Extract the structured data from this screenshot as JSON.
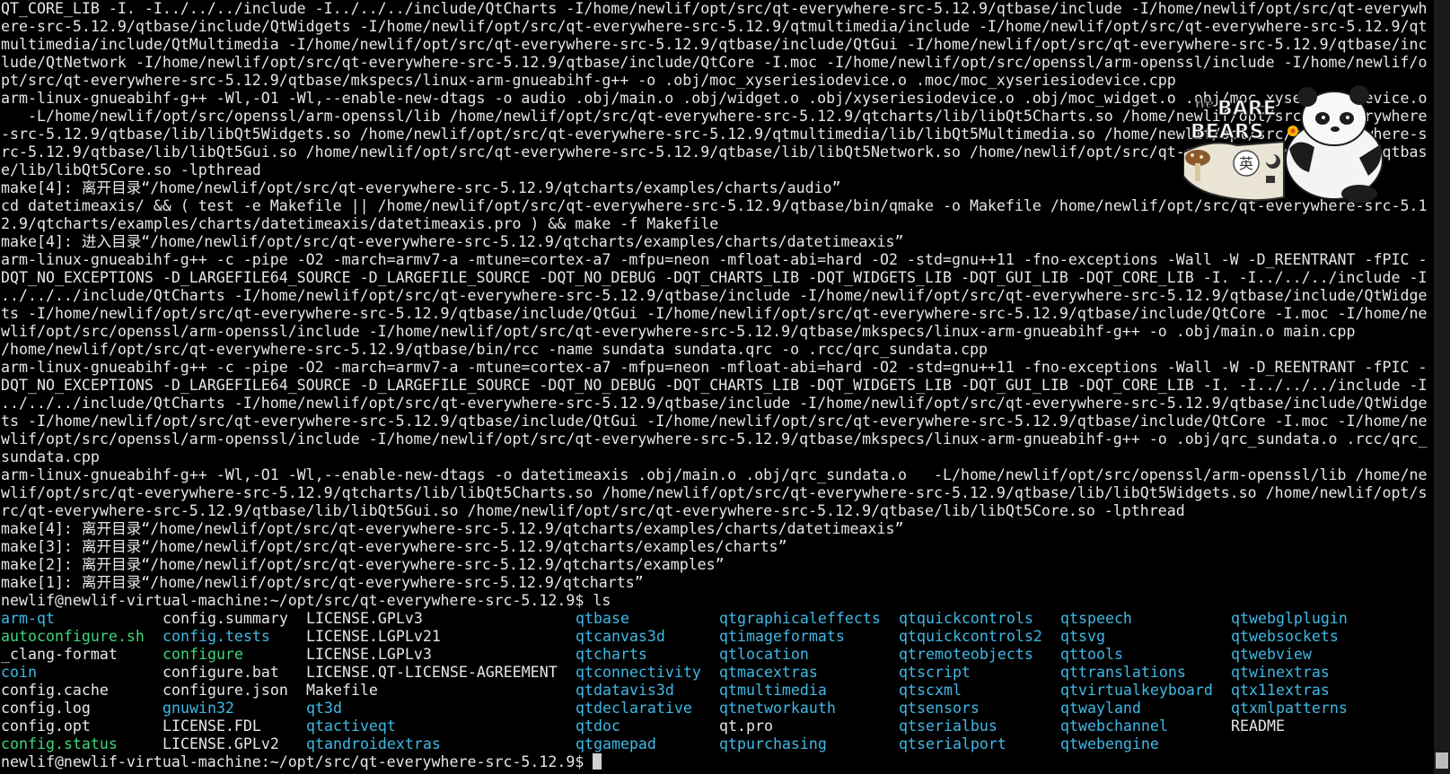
{
  "colors": {
    "background": "#000000",
    "text": "#e6e6e6",
    "directory": "#3fb9e6",
    "executable": "#3fd67a"
  },
  "sticker": {
    "line1": "We",
    "line2": "BARE",
    "line3": "BEARS",
    "ime_label": "英",
    "icon": "panda-bear-sticker-icon"
  },
  "build_output": [
    "QT_CORE_LIB -I. -I../../../include -I../../../include/QtCharts -I/home/newlif/opt/src/qt-everywhere-src-5.12.9/qtbase/include -I/home/newlif/opt/src/qt-everywh",
    "ere-src-5.12.9/qtbase/include/QtWidgets -I/home/newlif/opt/src/qt-everywhere-src-5.12.9/qtmultimedia/include -I/home/newlif/opt/src/qt-everywhere-src-5.12.9/qt",
    "multimedia/include/QtMultimedia -I/home/newlif/opt/src/qt-everywhere-src-5.12.9/qtbase/include/QtGui -I/home/newlif/opt/src/qt-everywhere-src-5.12.9/qtbase/inc",
    "lude/QtNetwork -I/home/newlif/opt/src/qt-everywhere-src-5.12.9/qtbase/include/QtCore -I.moc -I/home/newlif/opt/src/openssl/arm-openssl/include -I/home/newlif/o",
    "pt/src/qt-everywhere-src-5.12.9/qtbase/mkspecs/linux-arm-gnueabihf-g++ -o .obj/moc_xyseriesiodevice.o .moc/moc_xyseriesiodevice.cpp",
    "arm-linux-gnueabihf-g++ -Wl,-O1 -Wl,--enable-new-dtags -o audio .obj/main.o .obj/widget.o .obj/xyseriesiodevice.o .obj/moc_widget.o .obj/moc_xyseriesiodevice.o",
    "   -L/home/newlif/opt/src/openssl/arm-openssl/lib /home/newlif/opt/src/qt-everywhere-src-5.12.9/qtcharts/lib/libQt5Charts.so /home/newlif/opt/src/qt-everywhere",
    "-src-5.12.9/qtbase/lib/libQt5Widgets.so /home/newlif/opt/src/qt-everywhere-src-5.12.9/qtmultimedia/lib/libQt5Multimedia.so /home/newlif/opt/src/qt-everywhere-s",
    "rc-5.12.9/qtbase/lib/libQt5Gui.so /home/newlif/opt/src/qt-everywhere-src-5.12.9/qtbase/lib/libQt5Network.so /home/newlif/opt/src/qt-everywhere-src-5.12.9/qtbas",
    "e/lib/libQt5Core.so -lpthread",
    "make[4]: 离开目录“/home/newlif/opt/src/qt-everywhere-src-5.12.9/qtcharts/examples/charts/audio”",
    "cd datetimeaxis/ && ( test -e Makefile || /home/newlif/opt/src/qt-everywhere-src-5.12.9/qtbase/bin/qmake -o Makefile /home/newlif/opt/src/qt-everywhere-src-5.1",
    "2.9/qtcharts/examples/charts/datetimeaxis/datetimeaxis.pro ) && make -f Makefile",
    "make[4]: 进入目录“/home/newlif/opt/src/qt-everywhere-src-5.12.9/qtcharts/examples/charts/datetimeaxis”",
    "arm-linux-gnueabihf-g++ -c -pipe -O2 -march=armv7-a -mtune=cortex-a7 -mfpu=neon -mfloat-abi=hard -O2 -std=gnu++11 -fno-exceptions -Wall -W -D_REENTRANT -fPIC -",
    "DQT_NO_EXCEPTIONS -D_LARGEFILE64_SOURCE -D_LARGEFILE_SOURCE -DQT_NO_DEBUG -DQT_CHARTS_LIB -DQT_WIDGETS_LIB -DQT_GUI_LIB -DQT_CORE_LIB -I. -I../../../include -I",
    "../../../include/QtCharts -I/home/newlif/opt/src/qt-everywhere-src-5.12.9/qtbase/include -I/home/newlif/opt/src/qt-everywhere-src-5.12.9/qtbase/include/QtWidge",
    "ts -I/home/newlif/opt/src/qt-everywhere-src-5.12.9/qtbase/include/QtGui -I/home/newlif/opt/src/qt-everywhere-src-5.12.9/qtbase/include/QtCore -I.moc -I/home/ne",
    "wlif/opt/src/openssl/arm-openssl/include -I/home/newlif/opt/src/qt-everywhere-src-5.12.9/qtbase/mkspecs/linux-arm-gnueabihf-g++ -o .obj/main.o main.cpp",
    "/home/newlif/opt/src/qt-everywhere-src-5.12.9/qtbase/bin/rcc -name sundata sundata.qrc -o .rcc/qrc_sundata.cpp",
    "arm-linux-gnueabihf-g++ -c -pipe -O2 -march=armv7-a -mtune=cortex-a7 -mfpu=neon -mfloat-abi=hard -O2 -std=gnu++11 -fno-exceptions -Wall -W -D_REENTRANT -fPIC -",
    "DQT_NO_EXCEPTIONS -D_LARGEFILE64_SOURCE -D_LARGEFILE_SOURCE -DQT_NO_DEBUG -DQT_CHARTS_LIB -DQT_WIDGETS_LIB -DQT_GUI_LIB -DQT_CORE_LIB -I. -I../../../include -I",
    "../../../include/QtCharts -I/home/newlif/opt/src/qt-everywhere-src-5.12.9/qtbase/include -I/home/newlif/opt/src/qt-everywhere-src-5.12.9/qtbase/include/QtWidge",
    "ts -I/home/newlif/opt/src/qt-everywhere-src-5.12.9/qtbase/include/QtGui -I/home/newlif/opt/src/qt-everywhere-src-5.12.9/qtbase/include/QtCore -I.moc -I/home/ne",
    "wlif/opt/src/openssl/arm-openssl/include -I/home/newlif/opt/src/qt-everywhere-src-5.12.9/qtbase/mkspecs/linux-arm-gnueabihf-g++ -o .obj/qrc_sundata.o .rcc/qrc_",
    "sundata.cpp",
    "arm-linux-gnueabihf-g++ -Wl,-O1 -Wl,--enable-new-dtags -o datetimeaxis .obj/main.o .obj/qrc_sundata.o   -L/home/newlif/opt/src/openssl/arm-openssl/lib /home/ne",
    "wlif/opt/src/qt-everywhere-src-5.12.9/qtcharts/lib/libQt5Charts.so /home/newlif/opt/src/qt-everywhere-src-5.12.9/qtbase/lib/libQt5Widgets.so /home/newlif/opt/s",
    "rc/qt-everywhere-src-5.12.9/qtbase/lib/libQt5Gui.so /home/newlif/opt/src/qt-everywhere-src-5.12.9/qtbase/lib/libQt5Core.so -lpthread",
    "make[4]: 离开目录“/home/newlif/opt/src/qt-everywhere-src-5.12.9/qtcharts/examples/charts/datetimeaxis”",
    "make[3]: 离开目录“/home/newlif/opt/src/qt-everywhere-src-5.12.9/qtcharts/examples/charts”",
    "make[2]: 离开目录“/home/newlif/opt/src/qt-everywhere-src-5.12.9/qtcharts/examples”",
    "make[1]: 离开目录“/home/newlif/opt/src/qt-everywhere-src-5.12.9/qtcharts”"
  ],
  "prompt": "newlif@newlif-virtual-machine:~/opt/src/qt-everywhere-src-5.12.9$ ",
  "command": "ls",
  "ls_rows": [
    [
      {
        "name": "arm-qt",
        "kind": "dir"
      },
      {
        "name": "config.summary",
        "kind": "file"
      },
      {
        "name": "LICENSE.GPLv3",
        "kind": "file"
      },
      {
        "name": "qtbase",
        "kind": "dir"
      },
      {
        "name": "qtgraphicaleffects",
        "kind": "dir"
      },
      {
        "name": "qtquickcontrols",
        "kind": "dir"
      },
      {
        "name": "qtspeech",
        "kind": "dir"
      },
      {
        "name": "qtwebglplugin",
        "kind": "dir"
      }
    ],
    [
      {
        "name": "autoconfigure.sh",
        "kind": "exec"
      },
      {
        "name": "config.tests",
        "kind": "dir"
      },
      {
        "name": "LICENSE.LGPLv21",
        "kind": "file"
      },
      {
        "name": "qtcanvas3d",
        "kind": "dir"
      },
      {
        "name": "qtimageformats",
        "kind": "dir"
      },
      {
        "name": "qtquickcontrols2",
        "kind": "dir"
      },
      {
        "name": "qtsvg",
        "kind": "dir"
      },
      {
        "name": "qtwebsockets",
        "kind": "dir"
      }
    ],
    [
      {
        "name": "_clang-format",
        "kind": "file"
      },
      {
        "name": "configure",
        "kind": "exec"
      },
      {
        "name": "LICENSE.LGPLv3",
        "kind": "file"
      },
      {
        "name": "qtcharts",
        "kind": "dir"
      },
      {
        "name": "qtlocation",
        "kind": "dir"
      },
      {
        "name": "qtremoteobjects",
        "kind": "dir"
      },
      {
        "name": "qttools",
        "kind": "dir"
      },
      {
        "name": "qtwebview",
        "kind": "dir"
      }
    ],
    [
      {
        "name": "coin",
        "kind": "dir"
      },
      {
        "name": "configure.bat",
        "kind": "file"
      },
      {
        "name": "LICENSE.QT-LICENSE-AGREEMENT",
        "kind": "file"
      },
      {
        "name": "qtconnectivity",
        "kind": "dir"
      },
      {
        "name": "qtmacextras",
        "kind": "dir"
      },
      {
        "name": "qtscript",
        "kind": "dir"
      },
      {
        "name": "qttranslations",
        "kind": "dir"
      },
      {
        "name": "qtwinextras",
        "kind": "dir"
      }
    ],
    [
      {
        "name": "config.cache",
        "kind": "file"
      },
      {
        "name": "configure.json",
        "kind": "file"
      },
      {
        "name": "Makefile",
        "kind": "file"
      },
      {
        "name": "qtdatavis3d",
        "kind": "dir"
      },
      {
        "name": "qtmultimedia",
        "kind": "dir"
      },
      {
        "name": "qtscxml",
        "kind": "dir"
      },
      {
        "name": "qtvirtualkeyboard",
        "kind": "dir"
      },
      {
        "name": "qtx11extras",
        "kind": "dir"
      }
    ],
    [
      {
        "name": "config.log",
        "kind": "file"
      },
      {
        "name": "gnuwin32",
        "kind": "dir"
      },
      {
        "name": "qt3d",
        "kind": "dir"
      },
      {
        "name": "qtdeclarative",
        "kind": "dir"
      },
      {
        "name": "qtnetworkauth",
        "kind": "dir"
      },
      {
        "name": "qtsensors",
        "kind": "dir"
      },
      {
        "name": "qtwayland",
        "kind": "dir"
      },
      {
        "name": "qtxmlpatterns",
        "kind": "dir"
      }
    ],
    [
      {
        "name": "config.opt",
        "kind": "file"
      },
      {
        "name": "LICENSE.FDL",
        "kind": "file"
      },
      {
        "name": "qtactiveqt",
        "kind": "dir"
      },
      {
        "name": "qtdoc",
        "kind": "dir"
      },
      {
        "name": "qt.pro",
        "kind": "file"
      },
      {
        "name": "qtserialbus",
        "kind": "dir"
      },
      {
        "name": "qtwebchannel",
        "kind": "dir"
      },
      {
        "name": "README",
        "kind": "file"
      }
    ],
    [
      {
        "name": "config.status",
        "kind": "exec"
      },
      {
        "name": "LICENSE.GPLv2",
        "kind": "file"
      },
      {
        "name": "qtandroidextras",
        "kind": "dir"
      },
      {
        "name": "qtgamepad",
        "kind": "dir"
      },
      {
        "name": "qtpurchasing",
        "kind": "dir"
      },
      {
        "name": "qtserialport",
        "kind": "dir"
      },
      {
        "name": "qtwebengine",
        "kind": "dir"
      },
      {
        "name": "",
        "kind": "file"
      }
    ]
  ]
}
